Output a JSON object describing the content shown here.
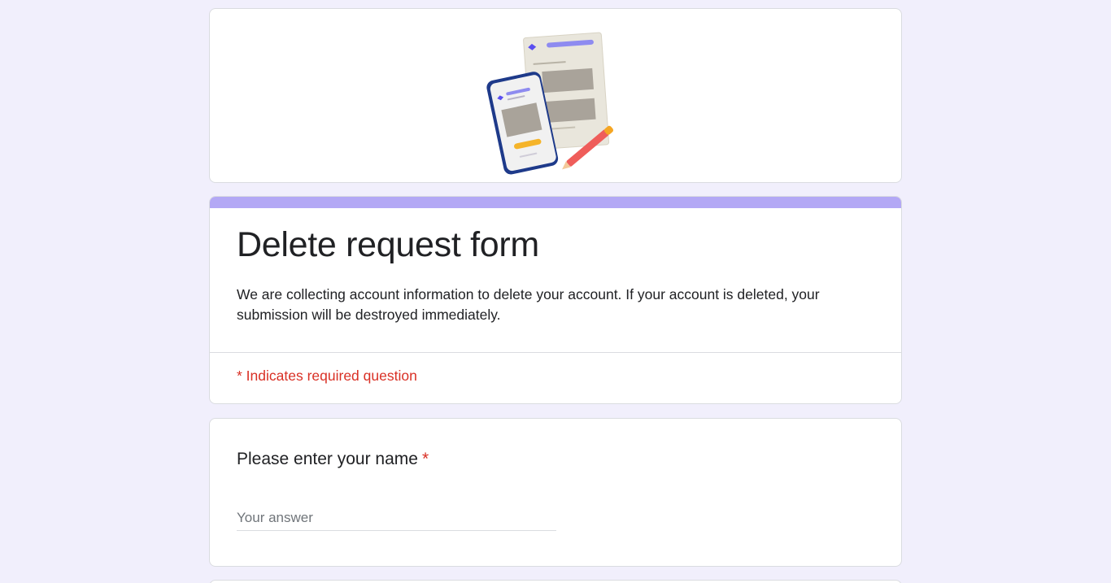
{
  "form": {
    "header_image_icon": "form-illustration-icon",
    "title": "Delete request form",
    "description": "We are collecting account information to delete your account. If your account is deleted, your submission will be destroyed immediately.",
    "required_note": "* Indicates required question",
    "accent_color": "#b3a8f5",
    "background_color": "#f1effc"
  },
  "questions": [
    {
      "title": "Please enter your name",
      "required_marker": "*",
      "value": "",
      "placeholder": "Your answer"
    }
  ]
}
